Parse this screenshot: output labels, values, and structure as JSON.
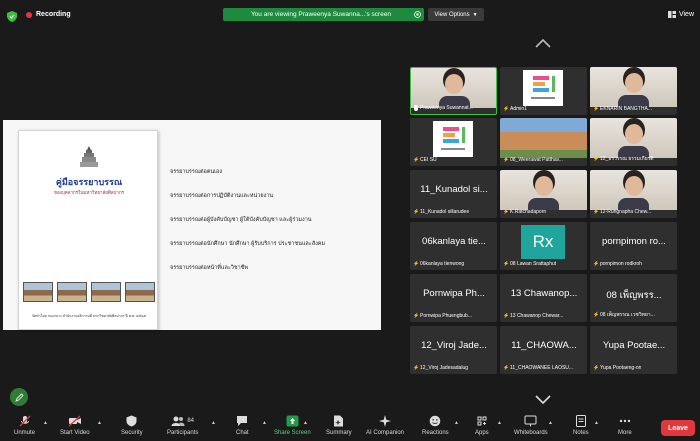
{
  "topbar": {
    "recording": "Recording",
    "share_banner": "You are viewing Praweenya Suwanna...'s screen",
    "view_options": "View Options",
    "view": "View"
  },
  "shared_doc": {
    "title": "คู่มือจรรยาบรรณ",
    "subtitle": "ของบุคลากรในมหาวิทยาลัยศิลปากร",
    "footer": "จัดทำโดย กองกลาง สำนักงานอธิการบดี มหาวิทยาลัยศิลปากร ปี พ.ศ. ๒๕๖๕",
    "bullets": [
      "จรรยาบรรณต่อตนเอง",
      "จรรยาบรรณต่อการปฏิบัติงานและหน่วยงาน",
      "จรรยาบรรณต่อผู้บังคับบัญชา ผู้ใต้บังคับบัญชา และผู้ร่วมงาน",
      "จรรยาบรรณต่อนักศึกษา นักศึกษา ผู้รับบริการ ประชาชนและสังคม",
      "จรรยาบรรณต่อหน้าที่และวิชาชีพ"
    ]
  },
  "participants": [
    {
      "label": "Praweenya Suwannat...",
      "kind": "video",
      "muted": false,
      "active": true
    },
    {
      "label": "Admin1",
      "kind": "logo",
      "muted": true
    },
    {
      "label": "EKNARIN BANGTHA...",
      "kind": "video",
      "muted": true
    },
    {
      "label": "CEI SU",
      "kind": "logo",
      "muted": true
    },
    {
      "label": "08_Weerawat Patthav...",
      "kind": "building",
      "muted": true
    },
    {
      "label": "12_อรวรรณ ธรรมเกียรติ",
      "kind": "video",
      "muted": true
    },
    {
      "name": "11_Kunadol si...",
      "label": "11_Kunadol sillarudee",
      "kind": "name",
      "muted": true
    },
    {
      "label": "K.Ratchadaporn",
      "kind": "video",
      "muted": true
    },
    {
      "label": "12-Rungnapha Chew...",
      "kind": "video",
      "muted": true
    },
    {
      "name": "06kanlaya tie...",
      "label": "06kanlaya tienwong",
      "kind": "name",
      "muted": true
    },
    {
      "name": "Rx",
      "label": "08 Lawan Srattaphut",
      "kind": "rx",
      "muted": true
    },
    {
      "name": "pornpimon ro...",
      "label": "pornpimon rodkroh",
      "kind": "name",
      "muted": true
    },
    {
      "name": "Pornwipa Ph...",
      "label": "Pornwipa Phuengbub...",
      "kind": "name",
      "muted": true
    },
    {
      "name": "13 Chawanop...",
      "label": "13 Chawanop Chewar...",
      "kind": "name",
      "muted": true
    },
    {
      "name": "08 เพ็ญพรร...",
      "label": "08 เพ็ญพรรณ เวชวิทยา...",
      "kind": "name",
      "muted": true
    },
    {
      "name": "12_Viroj Jade...",
      "label": "12_Viroj Jadesadalug",
      "kind": "name",
      "muted": true
    },
    {
      "name": "11_CHAOWA...",
      "label": "11_CHAOWANEE LAOSU...",
      "kind": "name",
      "muted": true
    },
    {
      "name": "Yupa Pootae...",
      "label": "Yupa Pootaeng-on",
      "kind": "name",
      "muted": true
    }
  ],
  "toolbar": {
    "unmute": "Unmute",
    "start_video": "Start Video",
    "security": "Security",
    "participants": "Participants",
    "participants_count": "84",
    "chat": "Chat",
    "share_screen": "Share Screen",
    "summary": "Summary",
    "ai_companion": "AI Companion",
    "reactions": "Reactions",
    "apps": "Apps",
    "whiteboards": "Whiteboards",
    "notes": "Notes",
    "more": "More",
    "leave": "Leave"
  },
  "colors": {
    "recording": "#e0383e",
    "banner": "#1e8a3e",
    "leave": "#e0383e",
    "tile": "#2f2f2f",
    "active_border": "#3fbf3f"
  }
}
